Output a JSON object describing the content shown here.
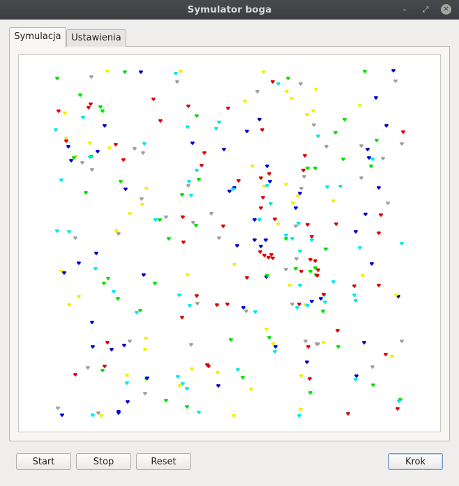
{
  "window": {
    "title": "Symulator boga",
    "minimize_glyph": "–",
    "maximize_glyph": "⤢",
    "close_glyph": "✕"
  },
  "tabs": [
    {
      "label": "Symulacja",
      "active": true
    },
    {
      "label": "Ustawienia",
      "active": false
    }
  ],
  "buttons": {
    "start": "Start",
    "stop": "Stop",
    "reset": "Reset",
    "step": "Krok"
  },
  "colors": {
    "red": "#e00000",
    "blue": "#0000d0",
    "green": "#00e000",
    "yellow": "#f0f000",
    "cyan": "#00e8e8",
    "gray": "#a0a0a0"
  },
  "creatures": [
    [
      "g",
      55,
      33
    ],
    [
      "gr",
      104,
      31
    ],
    [
      "y",
      127,
      23
    ],
    [
      "g",
      152,
      24
    ],
    [
      "b",
      175,
      24
    ],
    [
      "c",
      225,
      26
    ],
    [
      "y",
      232,
      23
    ],
    [
      "gr",
      227,
      38
    ],
    [
      "y",
      351,
      24
    ],
    [
      "r",
      364,
      38
    ],
    [
      "g",
      386,
      33
    ],
    [
      "c",
      372,
      41
    ],
    [
      "gr",
      404,
      41
    ],
    [
      "gr",
      342,
      52
    ],
    [
      "y",
      384,
      52
    ],
    [
      "y",
      391,
      62
    ],
    [
      "y",
      426,
      49
    ],
    [
      "g",
      496,
      23
    ],
    [
      "b",
      537,
      22
    ],
    [
      "gr",
      540,
      37
    ],
    [
      "g",
      88,
      57
    ],
    [
      "r",
      103,
      70
    ],
    [
      "r",
      100,
      75
    ],
    [
      "g",
      117,
      74
    ],
    [
      "g",
      120,
      80
    ],
    [
      "r",
      193,
      63
    ],
    [
      "r",
      243,
      73
    ],
    [
      "r",
      300,
      76
    ],
    [
      "y",
      324,
      66
    ],
    [
      "b",
      512,
      61
    ],
    [
      "y",
      489,
      72
    ],
    [
      "y",
      422,
      80
    ],
    [
      "y",
      413,
      85
    ],
    [
      "r",
      57,
      80
    ],
    [
      "y",
      66,
      83
    ],
    [
      "c",
      92,
      89
    ],
    [
      "g",
      255,
      87
    ],
    [
      "r",
      203,
      94
    ],
    [
      "c",
      287,
      96
    ],
    [
      "c",
      283,
      105
    ],
    [
      "g",
      467,
      92
    ],
    [
      "b",
      345,
      92
    ],
    [
      "r",
      349,
      107
    ],
    [
      "b",
      327,
      109
    ],
    [
      "gr",
      423,
      100
    ],
    [
      "b",
      527,
      101
    ],
    [
      "r",
      551,
      110
    ],
    [
      "gr",
      549,
      127
    ],
    [
      "c",
      53,
      107
    ],
    [
      "y",
      68,
      119
    ],
    [
      "b",
      123,
      101
    ],
    [
      "r",
      68,
      123
    ],
    [
      "b",
      71,
      131
    ],
    [
      "y",
      102,
      126
    ],
    [
      "r",
      139,
      128
    ],
    [
      "y",
      130,
      133
    ],
    [
      "gr",
      166,
      134
    ],
    [
      "c",
      180,
      127
    ],
    [
      "b",
      249,
      126
    ],
    [
      "c",
      242,
      103
    ],
    [
      "gr",
      178,
      140
    ],
    [
      "b",
      113,
      138
    ],
    [
      "g",
      104,
      145
    ],
    [
      "y",
      82,
      145
    ],
    [
      "b",
      75,
      151
    ],
    [
      "g",
      79,
      147
    ],
    [
      "gr",
      91,
      154
    ],
    [
      "c",
      102,
      146
    ],
    [
      "r",
      150,
      150
    ],
    [
      "r",
      266,
      140
    ],
    [
      "b",
      294,
      135
    ],
    [
      "c",
      429,
      116
    ],
    [
      "g",
      454,
      111
    ],
    [
      "gr",
      441,
      131
    ],
    [
      "gr",
      491,
      130
    ],
    [
      "g",
      513,
      122
    ],
    [
      "b",
      500,
      135
    ],
    [
      "r",
      410,
      144
    ],
    [
      "c",
      507,
      149
    ],
    [
      "gr",
      105,
      164
    ],
    [
      "r",
      262,
      158
    ],
    [
      "c",
      255,
      165
    ],
    [
      "y",
      335,
      159
    ],
    [
      "b",
      356,
      159
    ],
    [
      "g",
      414,
      162
    ],
    [
      "g",
      425,
      162
    ],
    [
      "r",
      408,
      165
    ],
    [
      "r",
      359,
      170
    ],
    [
      "b",
      360,
      181
    ],
    [
      "gr",
      409,
      174
    ],
    [
      "g",
      465,
      149
    ],
    [
      "b",
      502,
      147
    ],
    [
      "g",
      505,
      159
    ],
    [
      "gr",
      522,
      148
    ],
    [
      "gr",
      491,
      176
    ],
    [
      "c",
      61,
      179
    ],
    [
      "g",
      146,
      181
    ],
    [
      "b",
      153,
      192
    ],
    [
      "y",
      183,
      191
    ],
    [
      "c",
      244,
      181
    ],
    [
      "gr",
      243,
      187
    ],
    [
      "g",
      258,
      178
    ],
    [
      "c",
      247,
      201
    ],
    [
      "g",
      234,
      200
    ],
    [
      "r",
      315,
      180
    ],
    [
      "r",
      347,
      176
    ],
    [
      "y",
      352,
      188
    ],
    [
      "c",
      356,
      187
    ],
    [
      "y",
      383,
      185
    ],
    [
      "b",
      309,
      190
    ],
    [
      "b",
      302,
      195
    ],
    [
      "c",
      307,
      192
    ],
    [
      "r",
      350,
      204
    ],
    [
      "gr",
      405,
      191
    ],
    [
      "b",
      403,
      198
    ],
    [
      "c",
      442,
      189
    ],
    [
      "c",
      461,
      188
    ],
    [
      "b",
      516,
      190
    ],
    [
      "y",
      400,
      202
    ],
    [
      "g",
      96,
      197
    ],
    [
      "gr",
      176,
      206
    ],
    [
      "y",
      177,
      214
    ],
    [
      "y",
      159,
      227
    ],
    [
      "r",
      347,
      219
    ],
    [
      "b",
      397,
      219
    ],
    [
      "y",
      393,
      212
    ],
    [
      "c",
      361,
      213
    ],
    [
      "y",
      451,
      209
    ],
    [
      "gr",
      529,
      212
    ],
    [
      "gr",
      276,
      227
    ],
    [
      "gr",
      211,
      232
    ],
    [
      "r",
      235,
      232
    ],
    [
      "c",
      196,
      236
    ],
    [
      "g",
      202,
      236
    ],
    [
      "gr",
      250,
      240
    ],
    [
      "g",
      254,
      244
    ],
    [
      "b",
      497,
      228
    ],
    [
      "r",
      519,
      229
    ],
    [
      "c",
      345,
      236
    ],
    [
      "r",
      367,
      235
    ],
    [
      "b",
      338,
      236
    ],
    [
      "y",
      372,
      242
    ],
    [
      "r",
      293,
      245
    ],
    [
      "c",
      401,
      241
    ],
    [
      "gr",
      397,
      245
    ],
    [
      "r",
      414,
      243
    ],
    [
      "r",
      455,
      242
    ],
    [
      "c",
      55,
      252
    ],
    [
      "c",
      72,
      253
    ],
    [
      "y",
      140,
      252
    ],
    [
      "gr",
      143,
      256
    ],
    [
      "gr",
      81,
      262
    ],
    [
      "g",
      215,
      263
    ],
    [
      "r",
      236,
      268
    ],
    [
      "gr",
      287,
      262
    ],
    [
      "b",
      338,
      265
    ],
    [
      "b",
      354,
      265
    ],
    [
      "c",
      383,
      258
    ],
    [
      "g",
      383,
      263
    ],
    [
      "c",
      392,
      263
    ],
    [
      "r",
      420,
      260
    ],
    [
      "c",
      420,
      265
    ],
    [
      "b",
      483,
      253
    ],
    [
      "r",
      516,
      255
    ],
    [
      "c",
      549,
      270
    ],
    [
      "b",
      313,
      273
    ],
    [
      "b",
      347,
      274
    ],
    [
      "r",
      346,
      282
    ],
    [
      "r",
      352,
      287
    ],
    [
      "r",
      358,
      290
    ],
    [
      "r",
      364,
      291
    ],
    [
      "r",
      362,
      286
    ],
    [
      "g",
      440,
      278
    ],
    [
      "c",
      489,
      276
    ],
    [
      "b",
      111,
      284
    ],
    [
      "y",
      309,
      300
    ],
    [
      "c",
      403,
      281
    ],
    [
      "gr",
      398,
      292
    ],
    [
      "g",
      397,
      306
    ],
    [
      "r",
      418,
      293
    ],
    [
      "r",
      425,
      295
    ],
    [
      "g",
      425,
      305
    ],
    [
      "r",
      429,
      308
    ],
    [
      "g",
      418,
      310
    ],
    [
      "gr",
      383,
      307
    ],
    [
      "b",
      86,
      298
    ],
    [
      "y",
      61,
      310
    ],
    [
      "b",
      65,
      312
    ],
    [
      "c",
      110,
      306
    ],
    [
      "g",
      128,
      320
    ],
    [
      "b",
      179,
      315
    ],
    [
      "y",
      242,
      315
    ],
    [
      "b",
      355,
      318
    ],
    [
      "g",
      356,
      316
    ],
    [
      "r",
      405,
      310
    ],
    [
      "c",
      403,
      330
    ],
    [
      "y",
      388,
      330
    ],
    [
      "g",
      426,
      315
    ],
    [
      "r",
      428,
      316
    ],
    [
      "c",
      451,
      325
    ],
    [
      "r",
      481,
      331
    ],
    [
      "b",
      506,
      299
    ],
    [
      "y",
      493,
      316
    ],
    [
      "r",
      516,
      330
    ],
    [
      "c",
      136,
      339
    ],
    [
      "g",
      122,
      327
    ],
    [
      "g",
      195,
      327
    ],
    [
      "g",
      142,
      349
    ],
    [
      "y",
      86,
      346
    ],
    [
      "y",
      72,
      358
    ],
    [
      "r",
      255,
      345
    ],
    [
      "r",
      327,
      319
    ],
    [
      "c",
      230,
      344
    ],
    [
      "c",
      438,
      344
    ],
    [
      "b",
      420,
      353
    ],
    [
      "gr",
      392,
      357
    ],
    [
      "y",
      411,
      358
    ],
    [
      "c",
      414,
      359
    ],
    [
      "r",
      437,
      343
    ],
    [
      "b",
      433,
      349
    ],
    [
      "r",
      402,
      357
    ],
    [
      "c",
      481,
      344
    ],
    [
      "b",
      544,
      346
    ],
    [
      "c",
      439,
      354
    ],
    [
      "g",
      436,
      367
    ],
    [
      "c",
      399,
      362
    ],
    [
      "gr",
      256,
      356
    ],
    [
      "r",
      284,
      358
    ],
    [
      "r",
      299,
      357
    ],
    [
      "c",
      245,
      359
    ],
    [
      "b",
      322,
      362
    ],
    [
      "gr",
      326,
      367
    ],
    [
      "c",
      339,
      368
    ],
    [
      "g",
      174,
      366
    ],
    [
      "c",
      169,
      369
    ],
    [
      "r",
      234,
      376
    ],
    [
      "y",
      541,
      344
    ],
    [
      "c",
      483,
      352
    ],
    [
      "b",
      105,
      383
    ],
    [
      "y",
      355,
      393
    ],
    [
      "g",
      359,
      405
    ],
    [
      "b",
      368,
      418
    ],
    [
      "c",
      367,
      425
    ],
    [
      "y",
      365,
      414
    ],
    [
      "r",
      457,
      395
    ],
    [
      "gr",
      427,
      414
    ],
    [
      "y",
      437,
      412
    ],
    [
      "g",
      458,
      418
    ],
    [
      "r",
      415,
      418
    ],
    [
      "gr",
      411,
      410
    ],
    [
      "gr",
      429,
      414
    ],
    [
      "b",
      495,
      412
    ],
    [
      "gr",
      549,
      410
    ],
    [
      "r",
      526,
      429
    ],
    [
      "y",
      535,
      432
    ],
    [
      "r",
      127,
      412
    ],
    [
      "b",
      106,
      418
    ],
    [
      "b",
      133,
      422
    ],
    [
      "gr",
      159,
      410
    ],
    [
      "b",
      151,
      416
    ],
    [
      "y",
      182,
      406
    ],
    [
      "y",
      181,
      422
    ],
    [
      "g",
      304,
      408
    ],
    [
      "gr",
      247,
      415
    ],
    [
      "b",
      413,
      440
    ],
    [
      "r",
      81,
      458
    ],
    [
      "gr",
      99,
      448
    ],
    [
      "r",
      123,
      446
    ],
    [
      "g",
      120,
      452
    ],
    [
      "y",
      155,
      459
    ],
    [
      "y",
      248,
      450
    ],
    [
      "r",
      270,
      444
    ],
    [
      "r",
      272,
      446
    ],
    [
      "y",
      285,
      455
    ],
    [
      "c",
      314,
      451
    ],
    [
      "gr",
      507,
      447
    ],
    [
      "r",
      417,
      464
    ],
    [
      "b",
      484,
      460
    ],
    [
      "c",
      483,
      465
    ],
    [
      "c",
      155,
      470
    ],
    [
      "g",
      183,
      464
    ],
    [
      "b",
      184,
      463
    ],
    [
      "c",
      228,
      461
    ],
    [
      "c",
      235,
      471
    ],
    [
      "y",
      231,
      474
    ],
    [
      "g",
      321,
      462
    ],
    [
      "b",
      286,
      474
    ],
    [
      "y",
      333,
      479
    ],
    [
      "y",
      405,
      460
    ],
    [
      "g",
      418,
      484
    ],
    [
      "g",
      508,
      473
    ],
    [
      "gr",
      181,
      485
    ],
    [
      "g",
      211,
      495
    ],
    [
      "c",
      241,
      478
    ],
    [
      "g",
      241,
      504
    ],
    [
      "c",
      258,
      512
    ],
    [
      "b",
      156,
      497
    ],
    [
      "b",
      143,
      511
    ],
    [
      "gr",
      56,
      506
    ],
    [
      "b",
      62,
      516
    ],
    [
      "c",
      106,
      516
    ],
    [
      "gr",
      114,
      513
    ],
    [
      "y",
      118,
      517
    ],
    [
      "b",
      143,
      513
    ],
    [
      "y",
      308,
      517
    ],
    [
      "y",
      404,
      508
    ],
    [
      "c",
      402,
      517
    ],
    [
      "r",
      472,
      514
    ],
    [
      "g",
      547,
      494
    ],
    [
      "c",
      545,
      496
    ],
    [
      "r",
      543,
      507
    ]
  ]
}
